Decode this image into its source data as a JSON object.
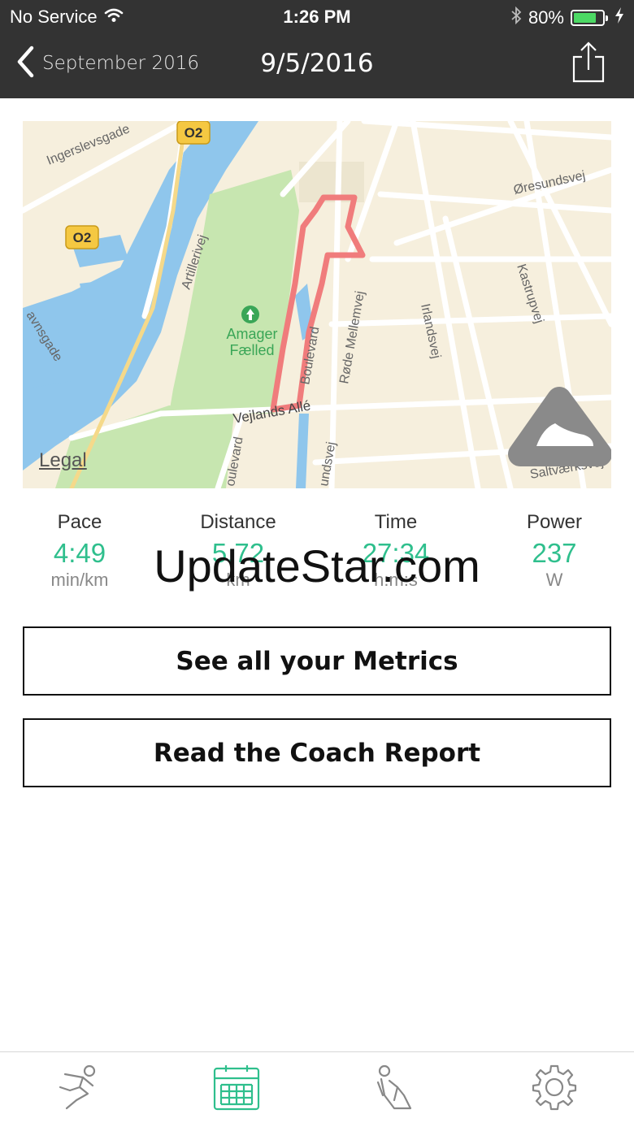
{
  "status_bar": {
    "carrier": "No Service",
    "time": "1:26 PM",
    "battery_percent": "80%",
    "battery_level": 0.8,
    "icons": [
      "wifi-icon",
      "bluetooth-icon",
      "battery-icon",
      "charging-icon"
    ]
  },
  "nav": {
    "back_label": "September 2016",
    "title": "9/5/2016",
    "share_icon": "share-icon"
  },
  "map": {
    "legal_label": "Legal",
    "streets": [
      "Ingerslevsgade",
      "Øresundsvej",
      "Artillerivej",
      "Amager Fælled",
      "Kastrupvej",
      "Irlandsvej",
      "Røde Mellemvej",
      "Boulevard",
      "Vejlands Allé",
      "Saltværksvej",
      "undsvej",
      "oulevard",
      "avnsgade"
    ],
    "road_badges": [
      "O2",
      "O2"
    ],
    "route_color": "#f07c7c",
    "park_color": "#c7e6b0",
    "water_color": "#8fc6ec"
  },
  "metrics": [
    {
      "label": "Pace",
      "value": "4:49",
      "unit": "min/km"
    },
    {
      "label": "Distance",
      "value": "5.72",
      "unit": "km"
    },
    {
      "label": "Time",
      "value": "27:34",
      "unit": "h:m:s"
    },
    {
      "label": "Power",
      "value": "237",
      "unit": "W"
    }
  ],
  "watermark": "UpdateStar.com",
  "buttons": {
    "metrics_label": "See all your Metrics",
    "coach_label": "Read the Coach Report"
  },
  "tabs": [
    {
      "name": "runner-icon",
      "active": false
    },
    {
      "name": "calendar-icon",
      "active": true
    },
    {
      "name": "stretching-icon",
      "active": false
    },
    {
      "name": "settings-icon",
      "active": false
    }
  ],
  "colors": {
    "header_bg": "#333333",
    "accent": "#2fbf8d"
  }
}
